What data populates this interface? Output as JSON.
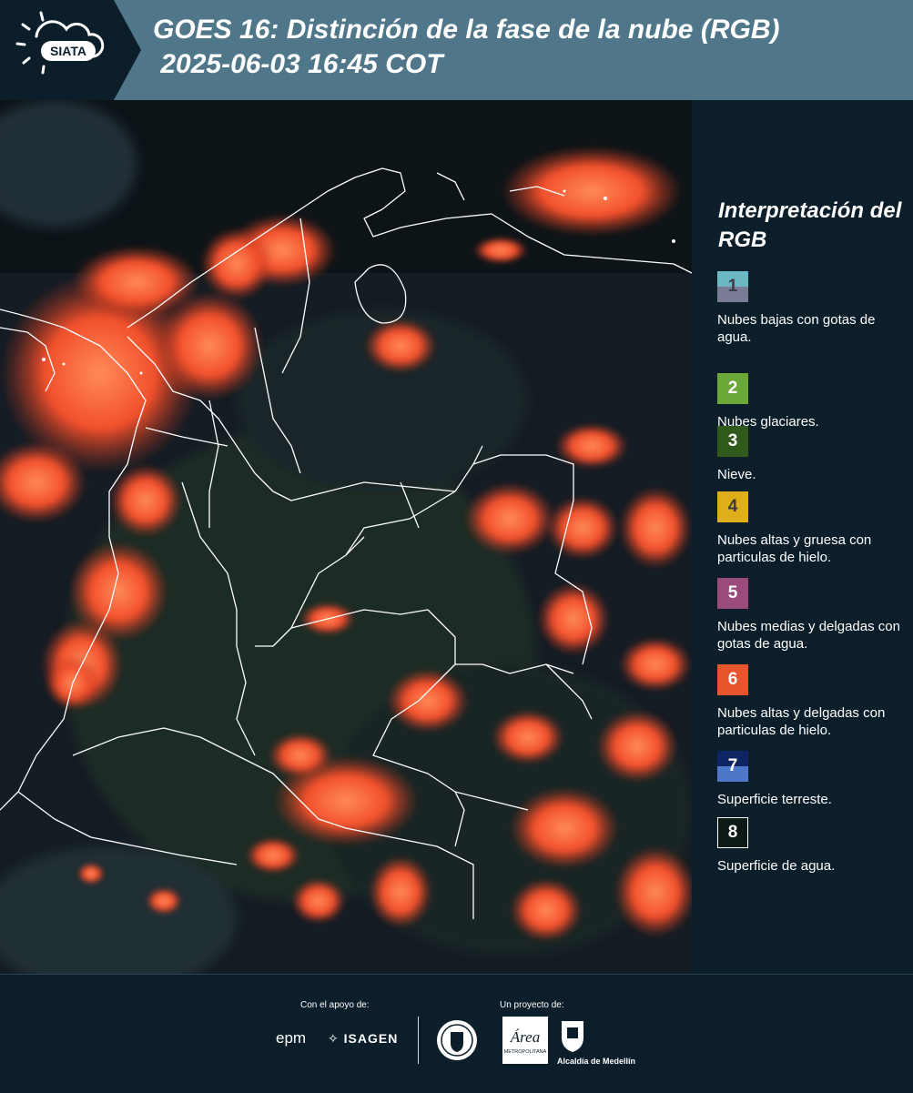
{
  "header": {
    "logo_text": "SIATA",
    "title_line1": "GOES 16: Distinción de la fase de la nube (RGB)",
    "title_line2": " 2025-06-03 16:45 COT"
  },
  "legend": {
    "title": "Interpretación del RGB",
    "items": [
      {
        "num": "1",
        "top_color": "#6cb7c4",
        "bottom_color": "#7a7b95",
        "num_color": "#3c3c4a",
        "label": "Nubes bajas con gotas de agua."
      },
      {
        "num": "2",
        "top_color": "#6aa937",
        "bottom_color": "#6aa937",
        "num_color": "#ffffff",
        "label": "Nubes glaciares."
      },
      {
        "num": "3",
        "top_color": "#2f5a1c",
        "bottom_color": "#2f5a1c",
        "num_color": "#ffffff",
        "label": "Nieve."
      },
      {
        "num": "4",
        "top_color": "#dfae1b",
        "bottom_color": "#dfae1b",
        "num_color": "#3a3a3a",
        "label": "Nubes altas y gruesa con particulas de hielo."
      },
      {
        "num": "5",
        "top_color": "#9a4a7b",
        "bottom_color": "#9a4a7b",
        "num_color": "#ffffff",
        "label": "Nubes medias y delgadas con gotas de agua."
      },
      {
        "num": "6",
        "top_color": "#e7552f",
        "bottom_color": "#e7552f",
        "num_color": "#ffffff",
        "label": "Nubes altas y delgadas con particulas de hielo."
      },
      {
        "num": "7",
        "top_color": "#0e2463",
        "bottom_color": "#4d78c9",
        "num_color": "#ffffff",
        "label": "Superficie terreste."
      },
      {
        "num": "8",
        "top_color": "#0d1a14",
        "bottom_color": "#0d1a14",
        "num_color": "#ffffff",
        "label": "Superficie de agua."
      }
    ]
  },
  "footer": {
    "support_label": "Con el apoyo de:",
    "project_label": "Un proyecto de:",
    "sponsor1": "epm",
    "sponsor2": "ISAGEN",
    "area_text": "Área",
    "area_sub": "METROPOLITANA",
    "alcaldia": "Alcaldía de Medellín"
  }
}
